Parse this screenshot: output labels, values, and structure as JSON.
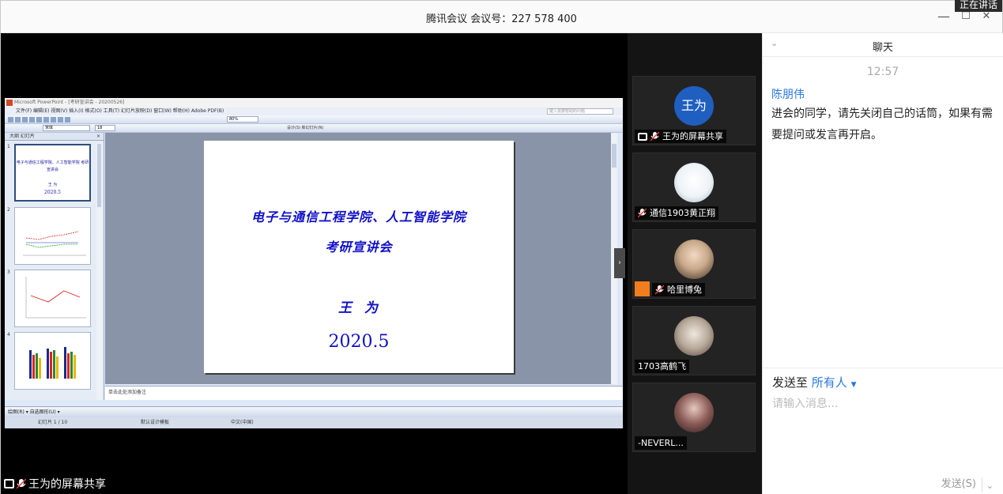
{
  "window": {
    "title": "腾讯会议 会议号：227 578 400",
    "speaking_tag": "正在讲话",
    "minimize": "—",
    "maximize": "☐",
    "close": "✕"
  },
  "stage": {
    "share_label": "王为的屏幕共享",
    "expand_arrow": "›"
  },
  "ppt": {
    "window_title": "Microsoft PowerPoint - [考研宣讲会 - 20200526]",
    "menu": "文件(F)  编辑(E)  视图(V)  插入(I)  格式(O)  工具(T)  幻灯片放映(D)  窗口(W)  帮助(H)  Adobe PDF(B)",
    "help_box": "键入需要帮助的问题",
    "zoom": "80%",
    "font": "宋体",
    "font_size": "18",
    "toolbar_extra": "设计(S)  新幻灯片(N)",
    "thumb_tabs": "大纲   幻灯片",
    "thumb_close": "×",
    "thumb_numbers": [
      "1",
      "2",
      "3",
      "4"
    ],
    "thumb1_title": "电子与通信工程学院、人工智能学院 考研宣讲会",
    "thumb1_author": "王  为",
    "thumb1_date": "2020.5",
    "slide": {
      "title_line1": "电子与通信工程学院、人工智能学院",
      "title_line2": "考研宣讲会",
      "author": "王为",
      "date": "2020.5"
    },
    "notes": "单击此处添加备注",
    "draw_bar": "绘图(R) ▾  自选图形(U) ▾",
    "status": {
      "slide_pos": "幻灯片 1 / 10",
      "design": "默认设计模板",
      "lang": "中文(中国)"
    }
  },
  "participants": [
    {
      "name": "王为的屏幕共享",
      "avatar_text": "王为",
      "avatar_color": "#1f5fc0"
    },
    {
      "name": "通信1903黄正翔",
      "avatar_color": "#e8eef2"
    },
    {
      "name": "哈里博兔",
      "avatar_color": "#c9a98a"
    },
    {
      "name": "1703高鹤飞",
      "avatar_color": "#b7a99a"
    },
    {
      "name": "-NEVERL...",
      "avatar_color": "#6b4a4a"
    }
  ],
  "chat": {
    "header": "聊天",
    "collapse": "⌄",
    "time": "12:57",
    "sender": "陈朋伟",
    "message": "进会的同学，请先关闭自己的话筒，如果有需要提问或发言再开启。",
    "send_to_label": "发送至",
    "send_to_target": "所有人",
    "input_placeholder": "请输入消息...",
    "send_button": "发送(S)",
    "send_menu": "⌄"
  },
  "colors": {
    "accent": "#2b79e0",
    "slide_text": "#1010c8",
    "badge_orange": "#f07d1e"
  }
}
